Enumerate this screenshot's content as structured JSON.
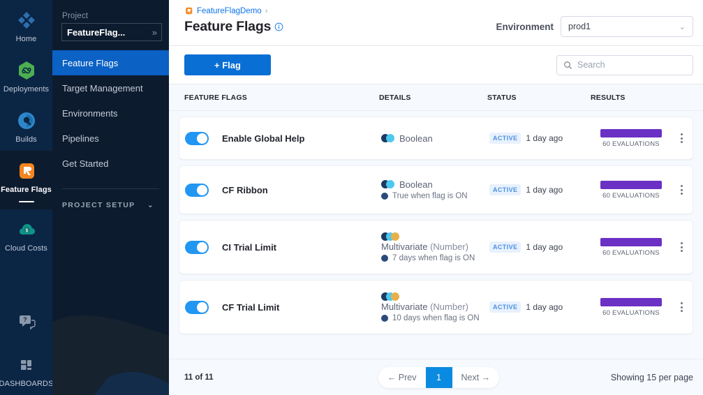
{
  "rail": {
    "items": [
      {
        "label": "Home",
        "icon": "home-diamond-icon",
        "active": false
      },
      {
        "label": "Deployments",
        "icon": "deployments-infinity-icon",
        "active": false
      },
      {
        "label": "Builds",
        "icon": "builds-circle-icon",
        "active": false
      },
      {
        "label": "Feature Flags",
        "icon": "feature-flags-icon",
        "active": true
      },
      {
        "label": "Cloud Costs",
        "icon": "cloud-costs-icon",
        "active": false
      }
    ],
    "help_icon": "help-chat-icon",
    "dashboards_label": "DASHBOARDS",
    "dashboards_icon": "dashboards-grid-icon"
  },
  "subnav": {
    "project_label": "Project",
    "project_name": "FeatureFlag...",
    "project_chevron": "»",
    "items": [
      {
        "label": "Feature Flags",
        "active": true
      },
      {
        "label": "Target Management",
        "active": false
      },
      {
        "label": "Environments",
        "active": false
      },
      {
        "label": "Pipelines",
        "active": false
      },
      {
        "label": "Get Started",
        "active": false
      }
    ],
    "setup_label": "PROJECT SETUP",
    "setup_chevron": "⌄"
  },
  "header": {
    "breadcrumb_project": "FeatureFlagDemo",
    "breadcrumb_separator": "›",
    "title": "Feature Flags",
    "info_icon": "info-icon",
    "environment_label": "Environment",
    "environment_value": "prod1",
    "environment_chevron": "⌄"
  },
  "toolbar": {
    "add_flag_label": "+ Flag",
    "search_placeholder": "Search",
    "search_value": "",
    "search_icon": "search-icon"
  },
  "table": {
    "columns": [
      "FEATURE FLAGS",
      "DETAILS",
      "STATUS",
      "RESULTS"
    ],
    "rows": [
      {
        "name": "Enable Global Help",
        "toggle_on": true,
        "type": "Boolean",
        "type_suffix": "",
        "variation": "",
        "status": "ACTIVE",
        "updated": "1 day ago",
        "evaluations": "60 EVALUATIONS",
        "dot_colors": [
          "#1c3a63",
          "#4cc9f0"
        ],
        "menu_icon": "kebab-menu-icon"
      },
      {
        "name": "CF Ribbon",
        "toggle_on": true,
        "type": "Boolean",
        "type_suffix": "",
        "variation": "True when flag is ON",
        "status": "ACTIVE",
        "updated": "1 day ago",
        "evaluations": "60 EVALUATIONS",
        "dot_colors": [
          "#1c3a63",
          "#4cc9f0"
        ],
        "menu_icon": "kebab-menu-icon"
      },
      {
        "name": "CI Trial Limit",
        "toggle_on": true,
        "type": "Multivariate",
        "type_suffix": "(Number)",
        "variation": "7 days when flag is ON",
        "status": "ACTIVE",
        "updated": "1 day ago",
        "evaluations": "60 EVALUATIONS",
        "dot_colors": [
          "#1c3a63",
          "#4cc9f0",
          "#e8b04b"
        ],
        "menu_icon": "kebab-menu-icon"
      },
      {
        "name": "CF Trial Limit",
        "toggle_on": true,
        "type": "Multivariate",
        "type_suffix": "(Number)",
        "variation": "10 days when flag is ON",
        "status": "ACTIVE",
        "updated": "1 day ago",
        "evaluations": "60 EVALUATIONS",
        "dot_colors": [
          "#1c3a63",
          "#4cc9f0",
          "#e8b04b"
        ],
        "menu_icon": "kebab-menu-icon"
      }
    ]
  },
  "footer": {
    "count": "11 of 11",
    "prev_label": "← Prev",
    "page_number": "1",
    "next_label": "Next →",
    "showing": "Showing 15 per page"
  },
  "colors": {
    "accent_blue": "#0a6fd4",
    "toggle_on": "#2196f3",
    "results_bar": "#6b30c4",
    "badge_bg": "#e8f1fd",
    "badge_text": "#4b90e2",
    "rail_bg": "#0b2545",
    "subnav_bg": "#0d1b2e",
    "nav_active": "#0b61c4"
  }
}
